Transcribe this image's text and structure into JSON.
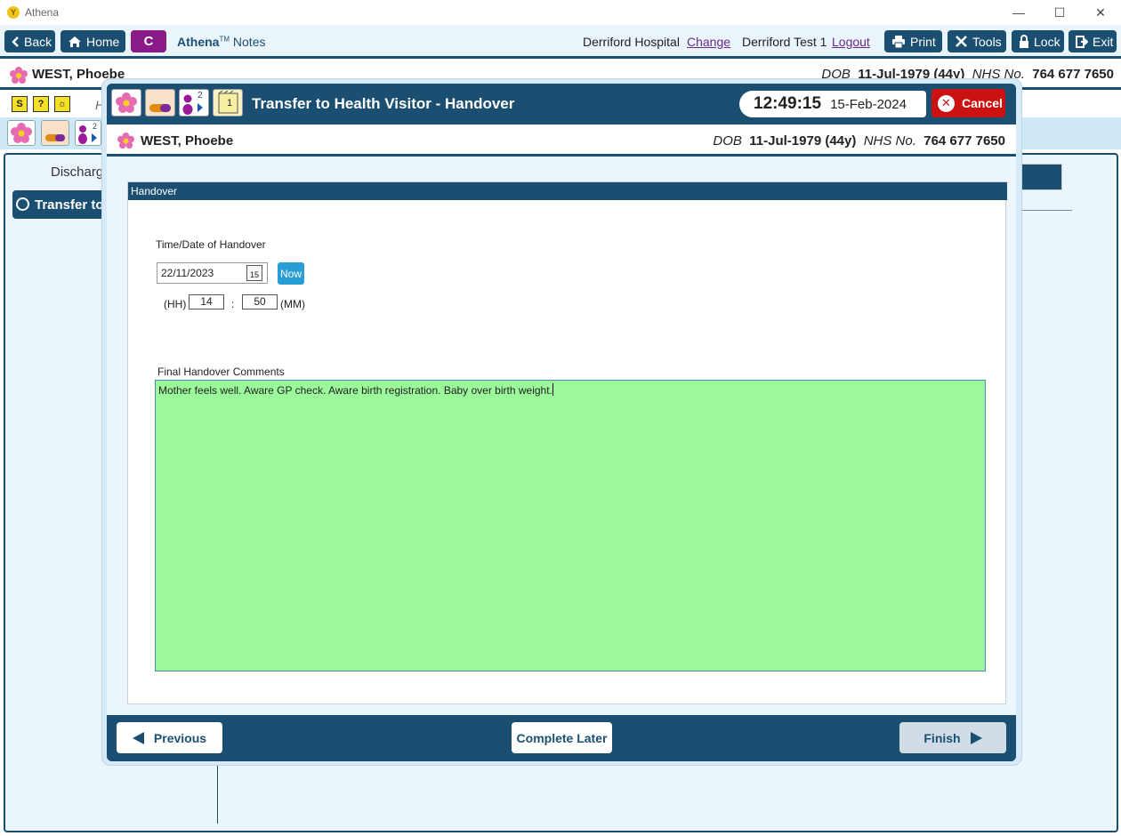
{
  "window": {
    "title": "Athena",
    "logo": "Y"
  },
  "toolbar": {
    "back": "Back",
    "home": "Home",
    "c": "C",
    "brand": "Athena",
    "tm": "TM",
    "notes": "Notes",
    "hospital": "Derriford Hospital",
    "change": "Change",
    "user": "Derriford Test 1",
    "logout": "Logout",
    "print": "Print",
    "tools": "Tools",
    "lock": "Lock",
    "exit": "Exit"
  },
  "patient": {
    "name": "WEST, Phoebe",
    "dob_label": "DOB",
    "dob": "11-Jul-1979 (44y)",
    "nhs_label": "NHS No.",
    "nhs": "764 677 7650"
  },
  "background": {
    "row2_text": "H",
    "discharge": "Discharg",
    "step": "Transfer to",
    "mini_icons": [
      "S",
      "?",
      "☼"
    ],
    "counter": "2"
  },
  "modal": {
    "title": "Transfer to Health Visitor - Handover",
    "time": "12:49:15",
    "date": "15-Feb-2024",
    "cancel": "Cancel",
    "counter": "2",
    "note_count": "1",
    "section": "Handover",
    "time_date_label": "Time/Date of Handover",
    "handover_date": "22/11/2023",
    "calendar_day": "15",
    "now": "Now",
    "hh_label": "(HH)",
    "hh": "14",
    "colon": ":",
    "mm": "50",
    "mm_label": "(MM)",
    "comments_label": "Final Handover Comments",
    "comments": "Mother feels well. Aware GP check. Aware birth registration. Baby over birth weight.",
    "previous": "Previous",
    "complete_later": "Complete Later",
    "finish": "Finish"
  },
  "colors": {
    "primary": "#1b4f72",
    "accent_purple": "#8b1a89",
    "cancel_red": "#cc1111",
    "comments_green": "#9cf99b",
    "now_blue": "#2a9dd6"
  }
}
